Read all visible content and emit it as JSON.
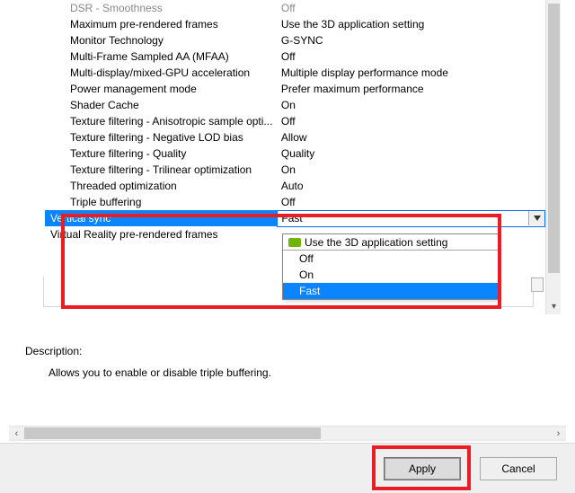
{
  "settings_rows": [
    {
      "feature": "DSR - Smoothness",
      "setting": "Off",
      "disabled": true
    },
    {
      "feature": "Maximum pre-rendered frames",
      "setting": "Use the 3D application setting"
    },
    {
      "feature": "Monitor Technology",
      "setting": "G-SYNC"
    },
    {
      "feature": "Multi-Frame Sampled AA (MFAA)",
      "setting": "Off"
    },
    {
      "feature": "Multi-display/mixed-GPU acceleration",
      "setting": "Multiple display performance mode"
    },
    {
      "feature": "Power management mode",
      "setting": "Prefer maximum performance"
    },
    {
      "feature": "Shader Cache",
      "setting": "On"
    },
    {
      "feature": "Texture filtering - Anisotropic sample opti...",
      "setting": "Off"
    },
    {
      "feature": "Texture filtering - Negative LOD bias",
      "setting": "Allow"
    },
    {
      "feature": "Texture filtering - Quality",
      "setting": "Quality"
    },
    {
      "feature": "Texture filtering - Trilinear optimization",
      "setting": "On"
    },
    {
      "feature": "Threaded optimization",
      "setting": "Auto"
    },
    {
      "feature": "Triple buffering",
      "setting": "Off"
    }
  ],
  "selected_row": {
    "feature": "Vertical sync",
    "setting": "Fast"
  },
  "below_row": {
    "feature": "Virtual Reality pre-rendered frames"
  },
  "dropdown": {
    "header": "Use the 3D application setting",
    "options": [
      "Off",
      "On",
      "Fast"
    ],
    "selected": "Fast"
  },
  "description": {
    "label": "Description:",
    "text": "Allows you to enable or disable triple buffering."
  },
  "buttons": {
    "apply": "Apply",
    "cancel": "Cancel"
  },
  "colors": {
    "highlight": "#ec1c24",
    "selection": "#0a84ff"
  }
}
